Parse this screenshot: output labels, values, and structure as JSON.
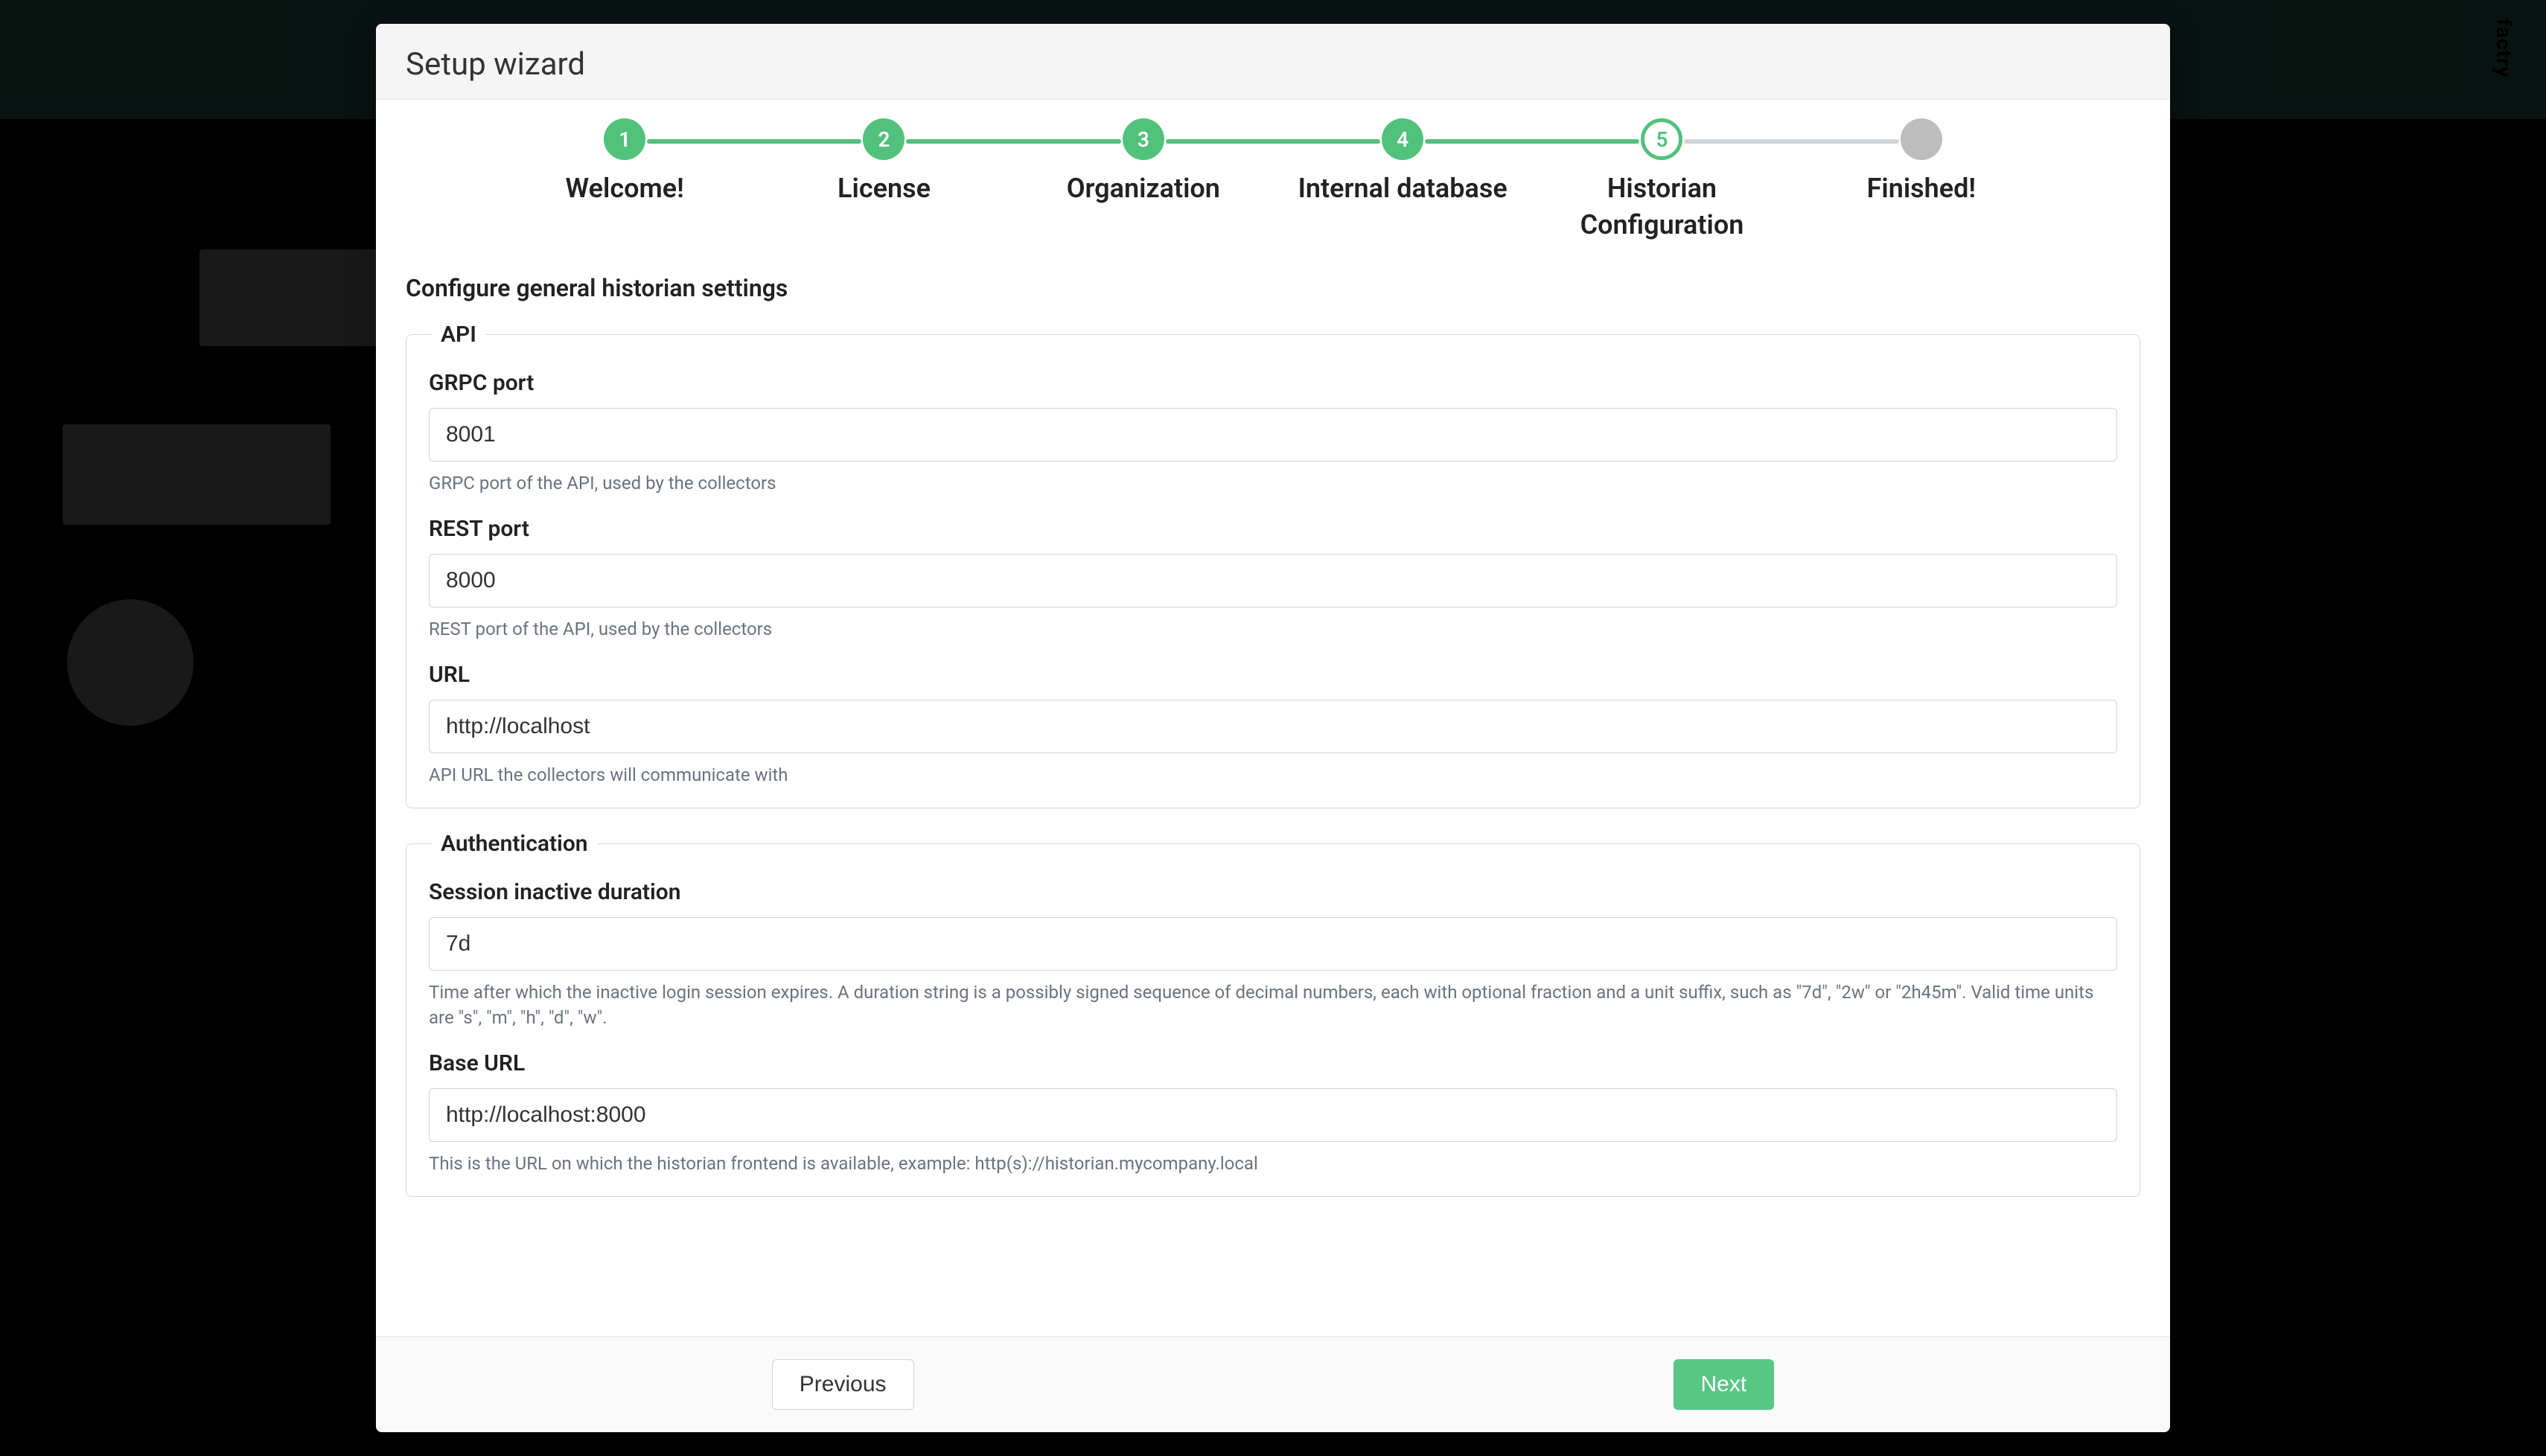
{
  "brand": "factry",
  "modal": {
    "title": "Setup wizard",
    "subtitle": "Configure general historian settings"
  },
  "steps": [
    {
      "num": "1",
      "label": "Welcome!",
      "state": "done"
    },
    {
      "num": "2",
      "label": "License",
      "state": "done"
    },
    {
      "num": "3",
      "label": "Organization",
      "state": "done"
    },
    {
      "num": "4",
      "label": "Internal database",
      "state": "done"
    },
    {
      "num": "5",
      "label": "Historian\nConfiguration",
      "state": "current"
    },
    {
      "num": "",
      "label": "Finished!",
      "state": "pending"
    }
  ],
  "fieldsets": {
    "api": {
      "legend": "API",
      "grpc_port": {
        "label": "GRPC port",
        "value": "8001",
        "help": "GRPC port of the API, used by the collectors"
      },
      "rest_port": {
        "label": "REST port",
        "value": "8000",
        "help": "REST port of the API, used by the collectors"
      },
      "url": {
        "label": "URL",
        "value": "http://localhost",
        "help": "API URL the collectors will communicate with"
      }
    },
    "auth": {
      "legend": "Authentication",
      "session_inactive": {
        "label": "Session inactive duration",
        "value": "7d",
        "help": "Time after which the inactive login session expires. A duration string is a possibly signed sequence of decimal numbers, each with optional fraction and a unit suffix, such as \"7d\", \"2w\" or \"2h45m\". Valid time units are \"s\", \"m\", \"h\", \"d\", \"w\"."
      },
      "base_url": {
        "label": "Base URL",
        "value": "http://localhost:8000",
        "help": "This is the URL on which the historian frontend is available, example: http(s)://historian.mycompany.local"
      }
    }
  },
  "footer": {
    "previous": "Previous",
    "next": "Next"
  }
}
